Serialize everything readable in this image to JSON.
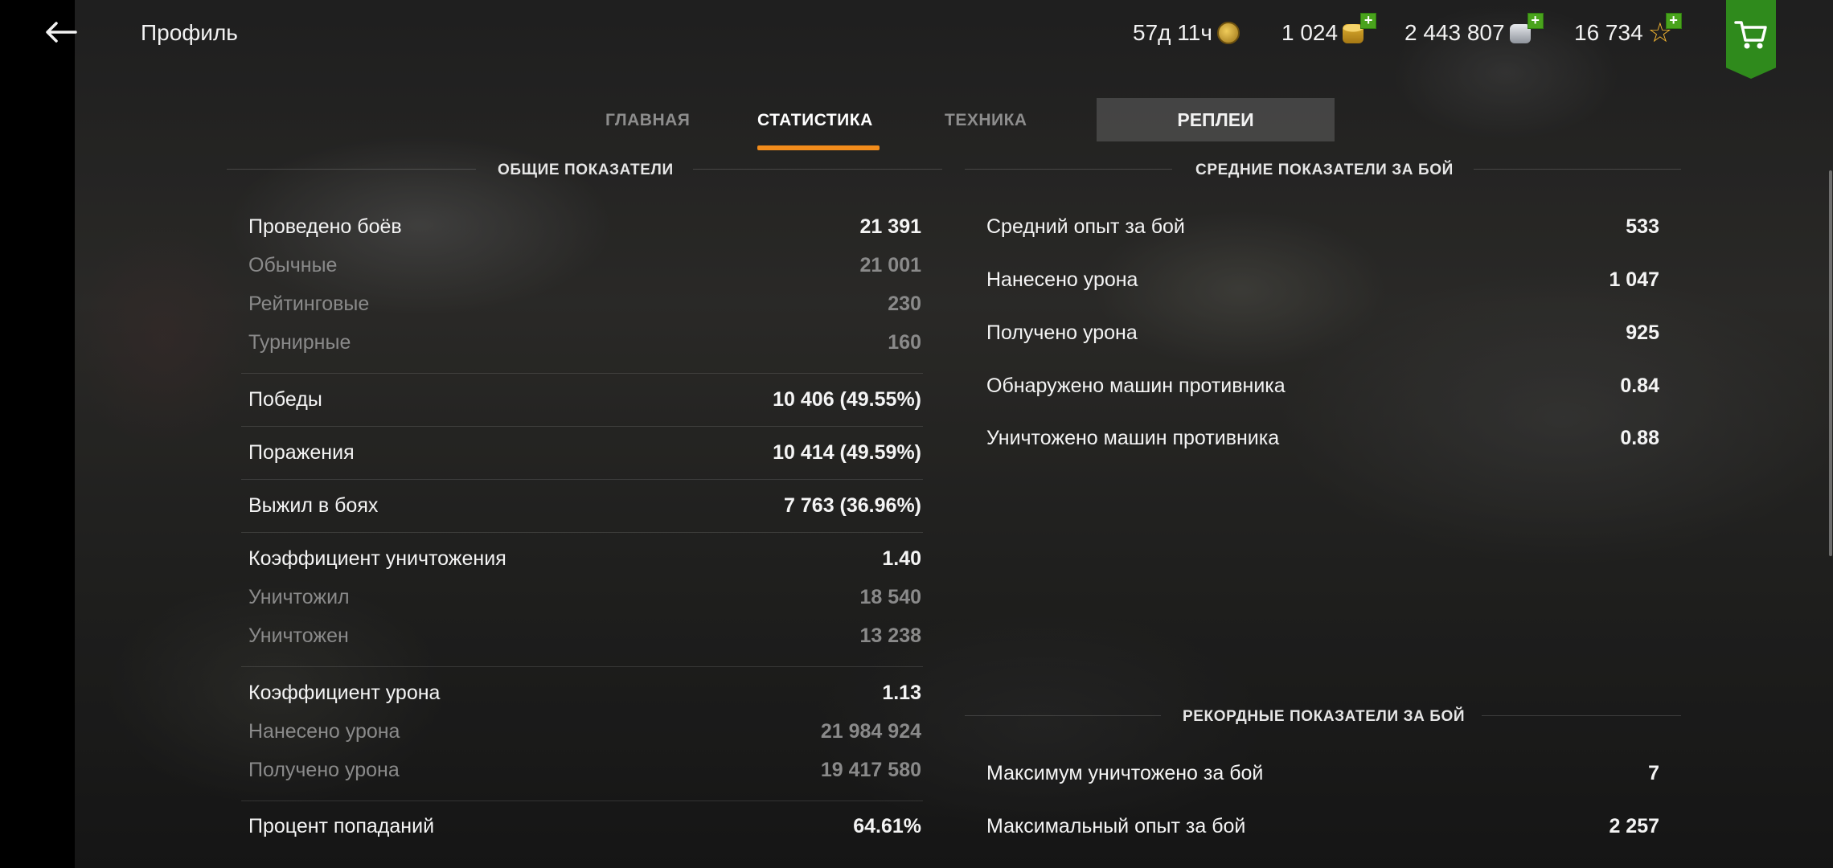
{
  "header": {
    "title": "Профиль",
    "premium_time": "57д 11ч",
    "gold": "1 024",
    "credits": "2 443 807",
    "free_xp": "16 734"
  },
  "tabs": [
    {
      "label": "ГЛАВНАЯ",
      "active": false
    },
    {
      "label": "СТАТИСТИКА",
      "active": true
    },
    {
      "label": "ТЕХНИКА",
      "active": false
    },
    {
      "label": "РЕПЛЕИ",
      "active": false
    }
  ],
  "general": {
    "title": "ОБЩИЕ ПОКАЗАТЕЛИ",
    "rows": [
      {
        "label": "Проведено боёв",
        "value": "21 391"
      },
      {
        "label": "Обычные",
        "value": "21 001"
      },
      {
        "label": "Рейтинговые",
        "value": "230"
      },
      {
        "label": "Турнирные",
        "value": "160"
      },
      {
        "label": "Победы",
        "value": "10 406 (49.55%)"
      },
      {
        "label": "Поражения",
        "value": "10 414 (49.59%)"
      },
      {
        "label": "Выжил в боях",
        "value": "7 763 (36.96%)"
      },
      {
        "label": "Коэффициент уничтожения",
        "value": "1.40"
      },
      {
        "label": "Уничтожил",
        "value": "18 540"
      },
      {
        "label": "Уничтожен",
        "value": "13 238"
      },
      {
        "label": "Коэффициент урона",
        "value": "1.13"
      },
      {
        "label": "Нанесено урона",
        "value": "21 984 924"
      },
      {
        "label": "Получено урона",
        "value": "19 417 580"
      },
      {
        "label": "Процент попаданий",
        "value": "64.61%"
      }
    ]
  },
  "average": {
    "title": "СРЕДНИЕ ПОКАЗАТЕЛИ ЗА БОЙ",
    "rows": [
      {
        "label": "Средний опыт за бой",
        "value": "533"
      },
      {
        "label": "Нанесено урона",
        "value": "1 047"
      },
      {
        "label": "Получено урона",
        "value": "925"
      },
      {
        "label": "Обнаружено машин противника",
        "value": "0.84"
      },
      {
        "label": "Уничтожено машин противника",
        "value": "0.88"
      }
    ]
  },
  "records": {
    "title": "РЕКОРДНЫЕ ПОКАЗАТЕЛИ ЗА БОЙ",
    "rows": [
      {
        "label": "Максимум уничтожено за бой",
        "value": "7"
      },
      {
        "label": "Максимальный опыт за бой",
        "value": "2 257"
      }
    ]
  },
  "colors": {
    "accent": "#f28c1b",
    "shop_green": "#2f8a1c",
    "plus_green": "#49a31c",
    "muted_text": "#8a8a8a"
  },
  "icons": {
    "back": "arrow-left-icon",
    "premium": "laurel-medal-icon",
    "gold": "gold-coins-icon",
    "credits": "silver-coins-icon",
    "free_xp": "star-icon",
    "add": "plus-icon",
    "shop": "cart-icon"
  }
}
